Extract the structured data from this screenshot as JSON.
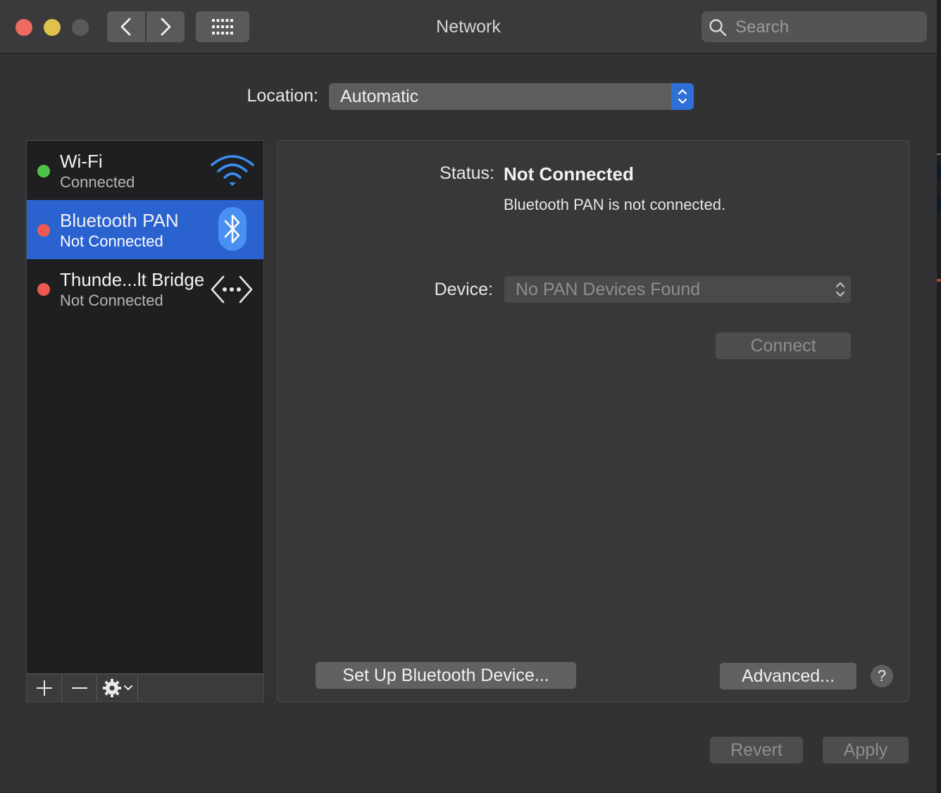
{
  "window": {
    "title": "Network",
    "search_placeholder": "Search"
  },
  "location": {
    "label": "Location:",
    "value": "Automatic"
  },
  "services": [
    {
      "name": "Wi-Fi",
      "status": "Connected",
      "status_color": "#4cc24a",
      "icon": "wifi-icon",
      "selected": false
    },
    {
      "name": "Bluetooth PAN",
      "status": "Not Connected",
      "status_color": "#ee5a52",
      "icon": "bluetooth-icon",
      "selected": true
    },
    {
      "name": "Thunde...lt Bridge",
      "status": "Not Connected",
      "status_color": "#ee5a52",
      "icon": "thunderbolt-bridge-icon",
      "selected": false
    }
  ],
  "detail": {
    "status_label": "Status:",
    "status_value": "Not Connected",
    "status_description": "Bluetooth PAN is not connected.",
    "device_label": "Device:",
    "device_value": "No PAN Devices Found",
    "connect_label": "Connect",
    "setup_label": "Set Up Bluetooth Device...",
    "advanced_label": "Advanced...",
    "help_label": "?"
  },
  "footer": {
    "revert_label": "Revert",
    "apply_label": "Apply"
  },
  "colors": {
    "accent": "#2a62d0",
    "connected": "#4cc24a",
    "disconnected": "#ee5a52"
  }
}
